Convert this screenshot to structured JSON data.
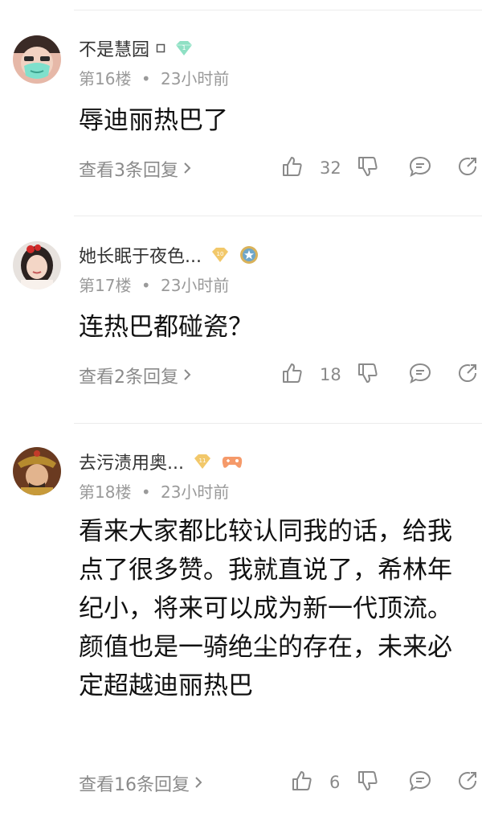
{
  "comments": [
    {
      "name": "不是慧园",
      "floor": "第16楼",
      "time": "23小时前",
      "text": "辱迪丽热巴了",
      "replies": "查看3条回复",
      "likes": "32",
      "badge1": "1"
    },
    {
      "name": "她长眠于夜色...",
      "floor": "第17楼",
      "time": "23小时前",
      "text": "连热巴都碰瓷？",
      "replies": "查看2条回复",
      "likes": "18",
      "badge1": "10"
    },
    {
      "name": "去污渍用奥...",
      "floor": "第18楼",
      "time": "23小时前",
      "text": "看来大家都比较认同我的话，给我点了很多赞。我就直说了，希林年纪小，将来可以成为新一代顶流。颜值也是一骑绝尘的存在，未来必定超越迪丽热巴",
      "replies": "查看16条回复",
      "likes": "6",
      "badge1": "11"
    }
  ],
  "separator": "•",
  "colors": {
    "muted": "#9a9a9a",
    "badge_green": "#7fd6b8",
    "badge_gold": "#f2c86a",
    "divider": "#ececec"
  }
}
